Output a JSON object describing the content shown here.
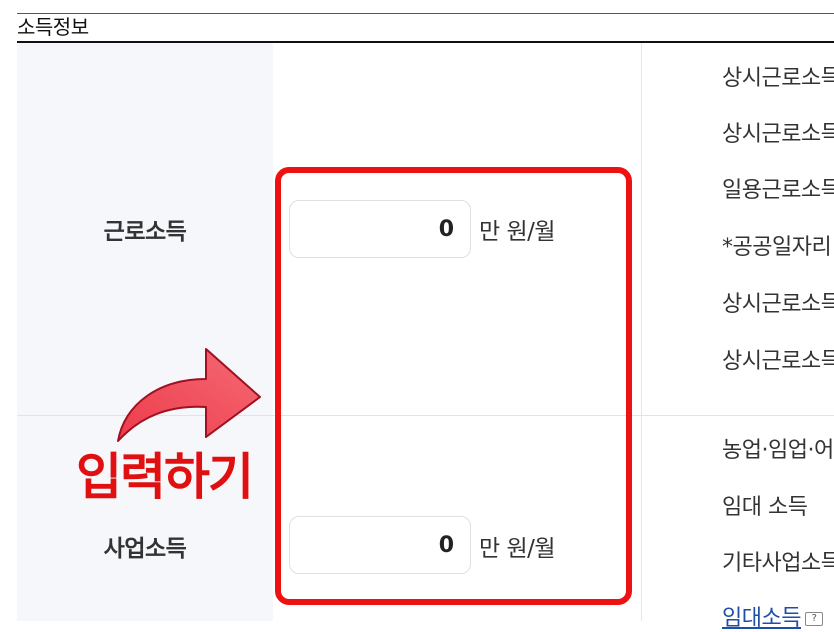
{
  "section": {
    "title": "소득정보"
  },
  "rows": [
    {
      "label": "근로소득",
      "value": "0",
      "unit": "만 원/월"
    },
    {
      "label": "사업소득",
      "value": "0",
      "unit": "만 원/월"
    }
  ],
  "notes": [
    "상시근로소득",
    "상시근로소득",
    "일용근로소득",
    "*공공일자리",
    "상시근로소득",
    "상시근로소득",
    "농업·임업·어",
    "임대 소득",
    "기타사업소득",
    "임대소득"
  ],
  "annotation": {
    "text": "입력하기",
    "color": "#e01010"
  }
}
